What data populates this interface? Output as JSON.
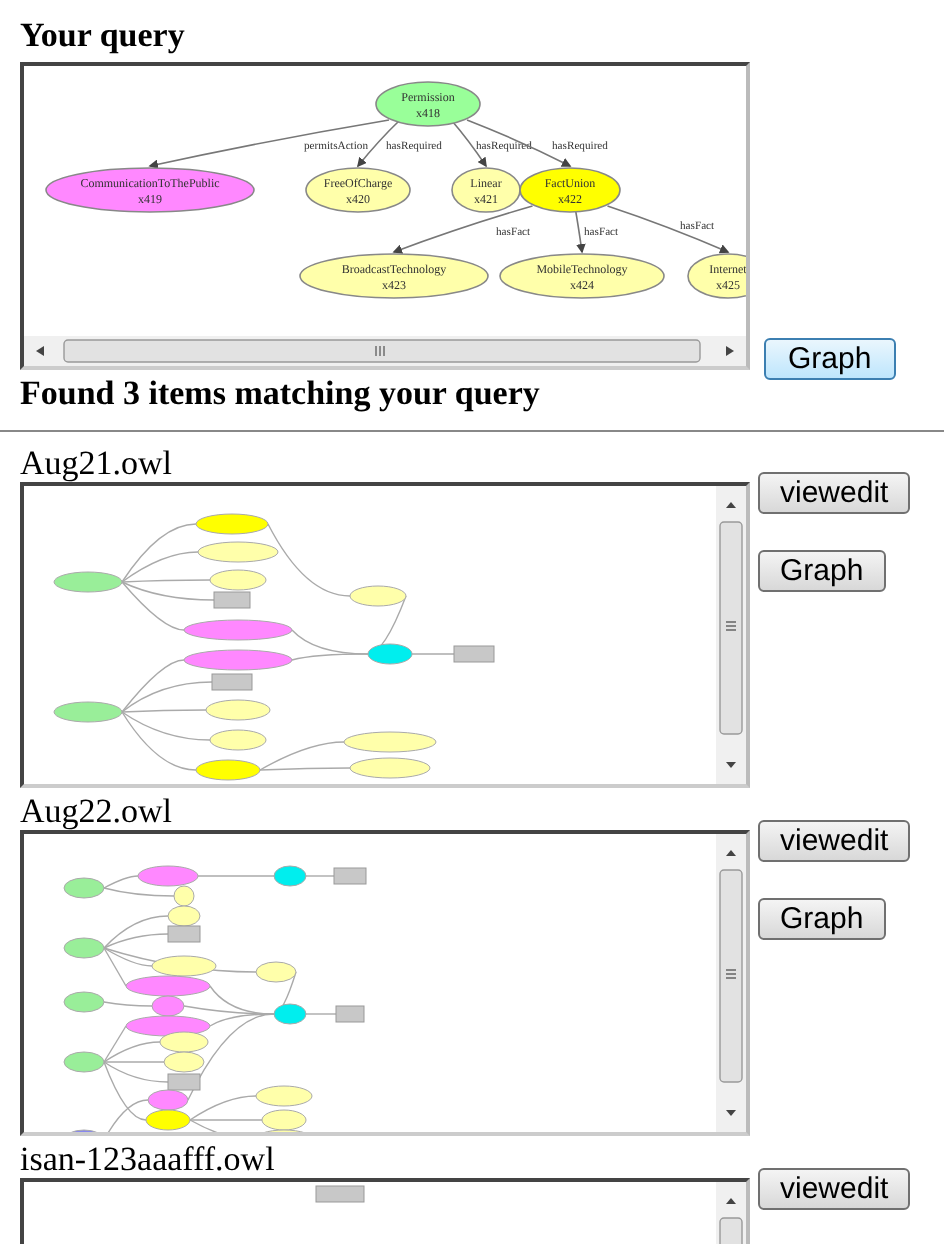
{
  "query": {
    "title": "Your query",
    "button": "Graph",
    "graph": {
      "root": {
        "label": "Permission",
        "code": "x418",
        "color": "#99ff99",
        "children": [
          {
            "edge": "permitsAction",
            "label": "CommunicationToThePublic",
            "code": "x419",
            "color": "#ff88ff"
          },
          {
            "edge": "hasRequired",
            "label": "FreeOfCharge",
            "code": "x420",
            "color": "#ffffaa"
          },
          {
            "edge": "hasRequired",
            "label": "Linear",
            "code": "x421",
            "color": "#ffffaa"
          },
          {
            "edge": "hasRequired",
            "label": "FactUnion",
            "code": "x422",
            "color": "#ffff00",
            "children": [
              {
                "edge": "hasFact",
                "label": "BroadcastTechnology",
                "code": "x423",
                "color": "#ffffaa"
              },
              {
                "edge": "hasFact",
                "label": "MobileTechnology",
                "code": "x424",
                "color": "#ffffaa"
              },
              {
                "edge": "hasFact",
                "label": "Internet",
                "code": "x425",
                "color": "#ffffaa"
              }
            ]
          }
        ]
      }
    }
  },
  "results_heading": "Found 3 items matching your query",
  "results": [
    {
      "name": "Aug21.owl",
      "buttons": [
        "viewedit",
        "Graph"
      ]
    },
    {
      "name": "Aug22.owl",
      "buttons": [
        "viewedit",
        "Graph"
      ]
    },
    {
      "name": "isan-123aaafff.owl",
      "buttons": [
        "viewedit"
      ]
    }
  ]
}
